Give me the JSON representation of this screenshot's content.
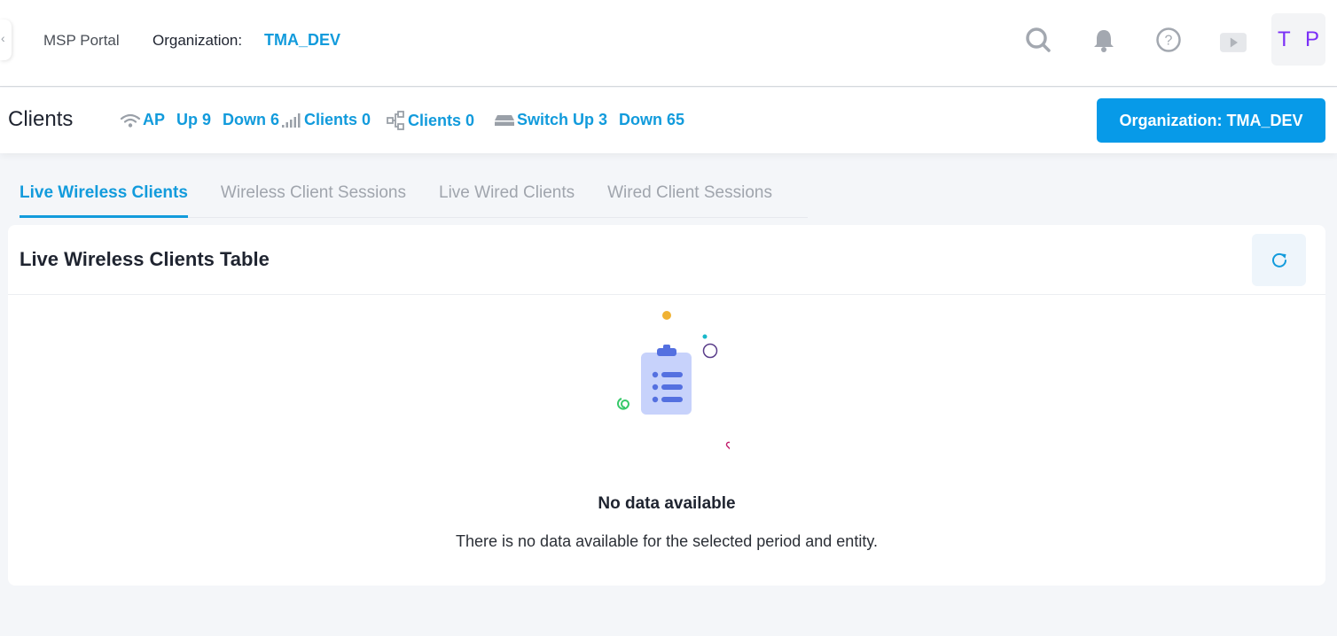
{
  "header": {
    "portal_label": "MSP Portal",
    "org_label": "Organization:",
    "org_value": "TMA_DEV",
    "avatar_initials": "T P",
    "icons": [
      "search-icon",
      "bell-icon",
      "help-icon",
      "video-icon"
    ]
  },
  "subheader": {
    "title": "Clients",
    "ap": {
      "label": "AP",
      "up_label": "Up 9",
      "down_label": "Down 6"
    },
    "wireless_clients": "Clients 0",
    "wired_clients": "Clients 0",
    "switch": {
      "label": "Switch Up 3",
      "down_label": "Down 65"
    },
    "org_button": "Organization: TMA_DEV"
  },
  "tabs": [
    {
      "label": "Live Wireless Clients",
      "active": true
    },
    {
      "label": "Wireless Client Sessions",
      "active": false
    },
    {
      "label": "Live Wired Clients",
      "active": false
    },
    {
      "label": "Wired Client Sessions",
      "active": false
    }
  ],
  "card": {
    "title": "Live Wireless Clients Table",
    "empty_title": "No data available",
    "empty_description": "There is no data available for the selected period and entity."
  },
  "colors": {
    "accent": "#129bdc",
    "button": "#079ae8",
    "avatar_text": "#7b2ff7",
    "background": "#f4f6f9"
  }
}
